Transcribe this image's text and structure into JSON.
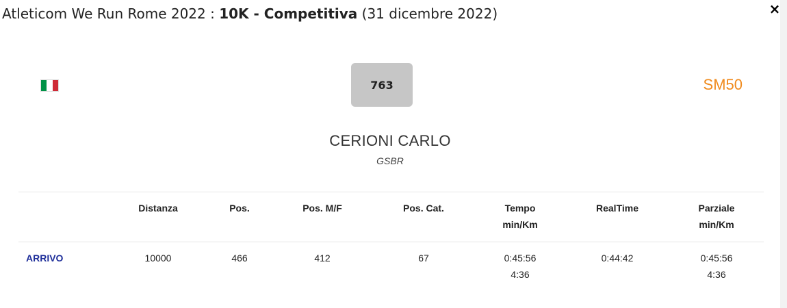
{
  "modal": {
    "title_prefix": "Atleticom We Run Rome 2022 : ",
    "title_event": "10K - Competitiva",
    "title_date": "(31 dicembre 2022)",
    "close_label": "×"
  },
  "athlete": {
    "flag_colors": [
      "#009246",
      "#ffffff",
      "#ce2b37"
    ],
    "bib": "763",
    "category": "SM50",
    "category_color": "#f08a1c",
    "name": "CERIONI CARLO",
    "team": "GSBR"
  },
  "results_table": {
    "headers": {
      "distanza": "Distanza",
      "pos": "Pos.",
      "pos_mf": "Pos. M/F",
      "pos_cat": "Pos. Cat.",
      "tempo": "Tempo",
      "tempo_sub": "min/Km",
      "realtime": "RealTime",
      "parziale": "Parziale",
      "parziale_sub": "min/Km"
    },
    "rows": [
      {
        "label": "ARRIVO",
        "distanza": "10000",
        "pos": "466",
        "pos_mf": "412",
        "pos_cat": "67",
        "tempo": "0:45:56",
        "tempo_pace": "4:36",
        "realtime": "0:44:42",
        "parziale": "0:45:56",
        "parziale_pace": "4:36"
      }
    ]
  }
}
